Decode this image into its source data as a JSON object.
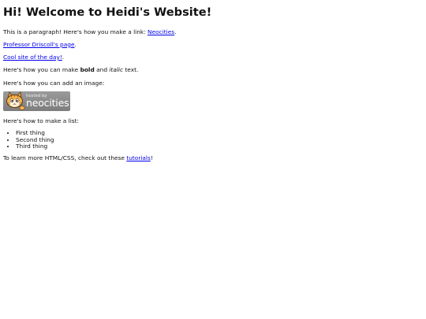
{
  "heading": "Hi! Welcome to Heidi's Website!",
  "para1": {
    "text": "This is a paragraph! Here's how you make a link: ",
    "link": "Neocities",
    "suffix": "."
  },
  "link_professor": {
    "link": "Professor Driscoll's page",
    "suffix": "."
  },
  "link_cool": {
    "link": "Cool site of the day!",
    "suffix": "."
  },
  "formatting": {
    "prefix": "Here's how you can make ",
    "bold": "bold",
    "middle": " and ",
    "italic": "italic",
    "suffix": " text."
  },
  "image_intro": "Here's how you can add an image:",
  "badge": {
    "hosted": "hosted by",
    "brand": "neocities",
    "icon": "neocities-cat-icon"
  },
  "list_intro": "Here's how to make a list:",
  "list_items": [
    "First thing",
    "Second thing",
    "Third thing"
  ],
  "footer": {
    "prefix": "To learn more HTML/CSS, check out these ",
    "link": "tutorials",
    "suffix": "!"
  },
  "colors": {
    "link": "#0000ee",
    "text": "#111111",
    "badge_bg": "#8a8a8a"
  }
}
